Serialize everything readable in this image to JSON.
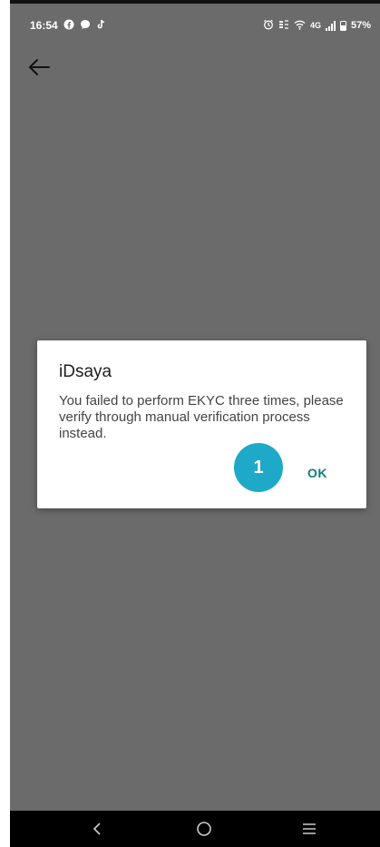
{
  "status_bar": {
    "time": "16:54",
    "network": "4G",
    "battery": "57%"
  },
  "dialog": {
    "title": "iDsaya",
    "message": "You failed to perform EKYC three times, please verify through manual verification process instead.",
    "ok_label": "OK"
  },
  "annotation": {
    "step_number": "1"
  },
  "colors": {
    "overlay": "#6b6b6b",
    "accent": "#0f7f78",
    "badge": "#1ea9c8"
  },
  "icons": {
    "back": "arrow-left-icon",
    "nav_back": "nav-back-icon",
    "nav_home": "nav-home-icon",
    "nav_recents": "nav-recents-icon"
  }
}
